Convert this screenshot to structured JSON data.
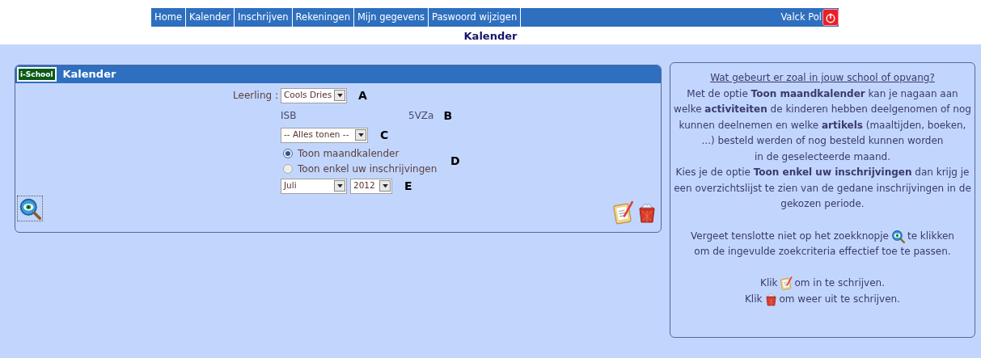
{
  "nav": {
    "items": [
      {
        "label": "Home"
      },
      {
        "label": "Kalender"
      },
      {
        "label": "Inschrijven"
      },
      {
        "label": "Rekeningen"
      },
      {
        "label": "Mijn gegevens"
      },
      {
        "label": "Paswoord wijzigen"
      }
    ],
    "user": "Valck Pol"
  },
  "page_title": "Kalender",
  "panel": {
    "title": "Kalender",
    "logo_text": "i-School",
    "student_label": "Leerling :",
    "student": "Cools Dries",
    "marker_a": "A",
    "school": "ISB",
    "class": "5VZa",
    "marker_b": "B",
    "filter": "-- Alles tonen --",
    "marker_c": "C",
    "options": [
      {
        "label": "Toon maandkalender",
        "selected": true
      },
      {
        "label": "Toon enkel uw inschrijvingen",
        "selected": false
      }
    ],
    "marker_d": "D",
    "month": "Juli",
    "year": "2012",
    "marker_e": "E"
  },
  "help": {
    "title": "Wat gebeurt er zoal in jouw school of opvang?",
    "paragraphs": [
      "Met de optie **Toon maandkalender** kan je nagaan aan welke **activiteiten** de kinderen hebben deelgenomen of nog kunnen deelnemen en welke **artikels** (maaltijden, boeken, ...) besteld werden of nog besteld kunnen worden",
      "in de geselecteerde maand.",
      "Kies je de optie **Toon enkel uw inschrijvingen** dan krijg je een overzichtslijst te zien van de gedane inschrijvingen in de gekozen periode."
    ],
    "search_before": "Vergeet tenslotte niet op het zoekknopje",
    "search_after": "te klikken",
    "search_line2": "om de ingevulde zoekcriteria effectief toe te passen.",
    "enroll_before": "Klik",
    "enroll_after": "om in te schrijven.",
    "unenroll_before": "Klik",
    "unenroll_after": "om weer uit te schrijven."
  }
}
